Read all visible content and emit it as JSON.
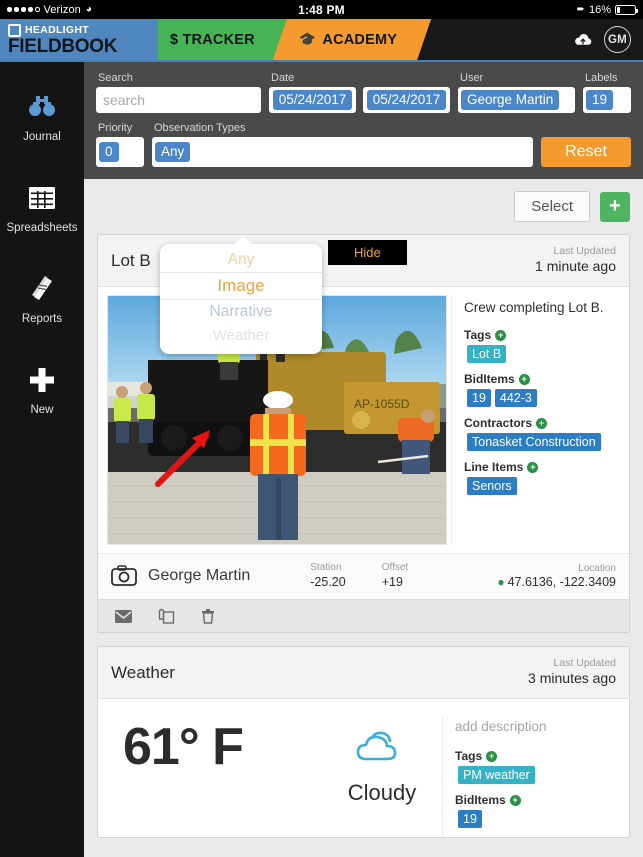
{
  "statusbar": {
    "carrier": "Verizon",
    "wifi_icon": "wifi-icon",
    "time": "1:48 PM",
    "location_icon": "location-arrow-icon",
    "battery_percent": "16%",
    "battery_icon": "battery-icon"
  },
  "header": {
    "brand_mark_icon": "headlight-logo-icon",
    "brand_name": "HEADLIGHT",
    "brand_sub": "FIELDBOOK",
    "tabs": [
      {
        "label": "$ TRACKER",
        "icon": "dollar-icon",
        "color": "#46b455"
      },
      {
        "label": "ACADEMY",
        "icon": "graduation-cap-icon",
        "color": "#f59a2e"
      }
    ],
    "cloud_icon": "cloud-upload-icon",
    "avatar_initials": "GM",
    "brand_color": "#5086be"
  },
  "sidebar": {
    "items": [
      {
        "label": "Journal",
        "icon": "binoculars-icon",
        "active": true
      },
      {
        "label": "Spreadsheets",
        "icon": "grid-table-icon",
        "active": false
      },
      {
        "label": "Reports",
        "icon": "book-icon",
        "active": false
      },
      {
        "label": "New",
        "icon": "plus-icon",
        "active": false
      }
    ]
  },
  "filters": {
    "search_label": "Search",
    "search_value": "",
    "search_placeholder": "search",
    "date_label": "Date",
    "date_from": "05/24/2017",
    "date_to": "05/24/2017",
    "user_label": "User",
    "user_value": "George Martin",
    "labels_label": "Labels",
    "labels_value": "19",
    "priority_label": "Priority",
    "priority_value": "0",
    "observation_types_label": "Observation Types",
    "observation_types_value": "Any",
    "reset_label": "Reset",
    "hide_label": "Hide",
    "accent_color": "#f59a2e",
    "pill_color": "#4a86c8"
  },
  "picker": {
    "options": [
      "Any",
      "Image",
      "Narrative",
      "Weather"
    ],
    "selected": "Image",
    "selected_color": "#f2a33c"
  },
  "toolbar": {
    "select_label": "Select",
    "add_label": "+",
    "add_icon": "plus-icon",
    "add_color": "#4fb45f"
  },
  "cards": [
    {
      "title": "Lot B",
      "updated_label": "Last Updated",
      "updated_time": "1 minute ago",
      "photo_icon": "construction-photo",
      "annotation_icon": "red-arrow-annotation",
      "description": "Crew completing Lot B.",
      "meta": [
        {
          "label": "Tags",
          "add_icon": "plus-circle-icon",
          "chips": [
            {
              "text": "Lot B",
              "style": "teal"
            }
          ]
        },
        {
          "label": "BidItems",
          "add_icon": "plus-circle-icon",
          "chips": [
            {
              "text": "19",
              "style": "blue"
            },
            {
              "text": "442-3",
              "style": "blue"
            }
          ]
        },
        {
          "label": "Contractors",
          "add_icon": "plus-circle-icon",
          "chips": [
            {
              "text": "Tonasket Construction",
              "style": "blue"
            }
          ]
        },
        {
          "label": "Line Items",
          "add_icon": "plus-circle-icon",
          "chips": [
            {
              "text": "Senors",
              "style": "blue"
            }
          ]
        }
      ],
      "footer": {
        "type_icon": "camera-icon",
        "author": "George Martin",
        "station_label": "Station",
        "station_value": "-25.20",
        "offset_label": "Offset",
        "offset_value": "+19",
        "location_label": "Location",
        "location_value": "47.6136, -122.3409",
        "location_pin_icon": "map-pin-icon"
      },
      "actions": [
        {
          "icon": "envelope-icon",
          "name": "email-action"
        },
        {
          "icon": "copy-icon",
          "name": "duplicate-action"
        },
        {
          "icon": "trash-icon",
          "name": "delete-action"
        }
      ]
    }
  ],
  "weather_card": {
    "title": "Weather",
    "updated_label": "Last Updated",
    "updated_time": "3 minutes ago",
    "temperature": "61° F",
    "condition": "Cloudy",
    "condition_icon": "cloud-icon",
    "add_description": "add description",
    "meta": [
      {
        "label": "Tags",
        "add_icon": "plus-circle-icon",
        "chips": [
          {
            "text": "PM weather",
            "style": "teal"
          }
        ]
      },
      {
        "label": "BidItems",
        "add_icon": "plus-circle-icon",
        "chips": [
          {
            "text": "19",
            "style": "blue"
          }
        ]
      }
    ]
  }
}
